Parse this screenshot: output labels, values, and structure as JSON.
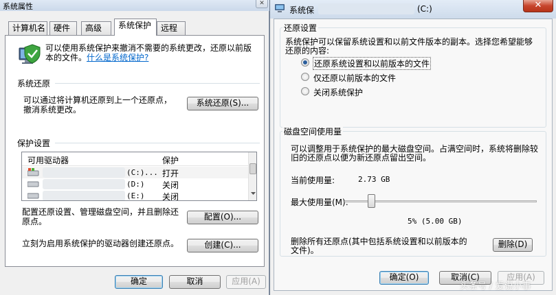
{
  "left_window": {
    "title": "系统属性",
    "close_glyph": "✕",
    "tabs": [
      "计算机名",
      "硬件",
      "高级",
      "系统保护",
      "远程"
    ],
    "intro": {
      "line1": "可以使用系统保护来撤消不需要的系统更改，还原以前版",
      "line2_prefix": "本的文件。",
      "link": "什么是系统保护?"
    },
    "system_restore": {
      "heading": "系统还原",
      "desc_line1": "可以通过将计算机还原到上一个还原点，",
      "desc_line2": "撤消系统更改。",
      "button": "系统还原(S)..."
    },
    "protection": {
      "heading": "保护设置",
      "col_drive": "可用驱动器",
      "col_protect": "保护",
      "drives": [
        {
          "letter": "(C:)",
          "dots": "...",
          "status": "打开"
        },
        {
          "letter": "(D:)",
          "status": "关闭"
        },
        {
          "letter": "(E:)",
          "status": "关闭"
        }
      ],
      "configure_line1": "配置还原设置、管理磁盘空间，并且删除还",
      "configure_line2": "原点。",
      "configure_button": "配置(O)...",
      "create_text": "立刻为启用系统保护的驱动器创建还原点。",
      "create_button": "创建(C)..."
    },
    "footer": {
      "ok": "确定",
      "cancel": "取消",
      "apply": "应用(A)"
    }
  },
  "right_window": {
    "title_prefix": "系统保",
    "title_suffix": "(C:)",
    "close_glyph": "✕",
    "restore_settings": {
      "heading": "还原设置",
      "desc_line1": "系统保护可以保留系统设置和以前文件版本的副本。选择您希望能够",
      "desc_line2": "还原的内容:",
      "options": [
        {
          "label": "还原系统设置和以前版本的文件",
          "checked": true
        },
        {
          "label": "仅还原以前版本的文件",
          "checked": false
        },
        {
          "label": "关闭系统保护",
          "checked": false
        }
      ]
    },
    "disk_usage": {
      "heading": "磁盘空间使用量",
      "desc_line1": "可以调整用于系统保护的最大磁盘空间。占满空间时，系统将删除较",
      "desc_line2": "旧的还原点以便为新还原点留出空间。",
      "current_label": "当前使用量:",
      "current_value": "2.73 GB",
      "max_label": "最大使用量(M):",
      "max_percent": 5,
      "max_value": "5% (5.00 GB)",
      "delete_line1": "删除所有还原点(其中包括系统设置和以前版本的",
      "delete_line2": "文件)。",
      "delete_button": "删除(D)"
    },
    "footer": {
      "ok": "确定(O)",
      "cancel": "取消(C)",
      "apply": "应用(A)"
    }
  },
  "watermark": "头条号 / 爱说小事",
  "colors": {
    "link": "#0066cc",
    "radio_dot": "#2b5e9c",
    "close_red": "#c7452d"
  }
}
